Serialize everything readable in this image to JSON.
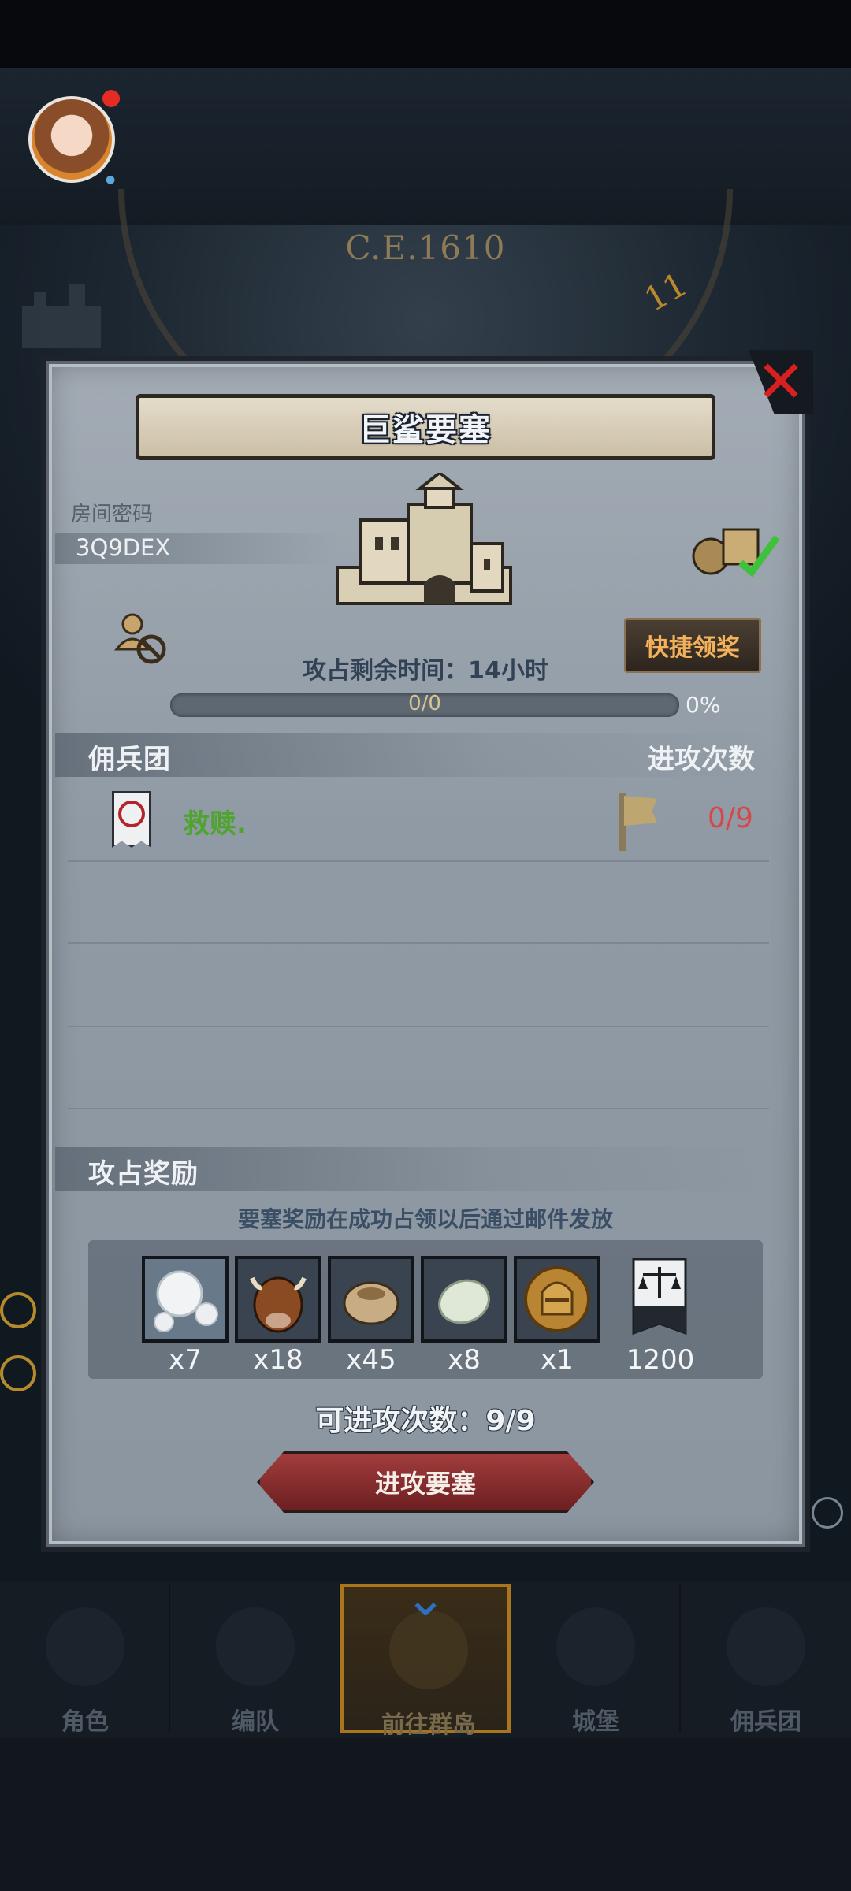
{
  "background": {
    "year": "C.E.1610",
    "clock_number": "11"
  },
  "dialog": {
    "title": "巨鲨要塞",
    "room_password_label": "房间密码",
    "room_password": "3Q9DEX",
    "quick_claim_label": "快捷领奖",
    "time_remaining": "攻占剩余时间：14小时",
    "progress_text": "0/0",
    "progress_percent": "0%",
    "progress_fraction": 0,
    "mercenary_header": "佣兵团",
    "attack_times_header": "进攻次数",
    "mercenaries": [
      {
        "name": "救赎.",
        "attacks": "0/9"
      }
    ],
    "rewards_header": "攻占奖励",
    "rewards_note": "要塞奖励在成功占领以后通过邮件发放",
    "rewards": [
      {
        "icon": "pearl-icon",
        "qty": "x7"
      },
      {
        "icon": "ox-icon",
        "qty": "x18"
      },
      {
        "icon": "grain-sack-icon",
        "qty": "x45"
      },
      {
        "icon": "gem-stone-icon",
        "qty": "x8"
      },
      {
        "icon": "knight-helmet-medal-icon",
        "qty": "x1"
      },
      {
        "icon": "justice-banner-icon",
        "qty": "1200"
      }
    ],
    "attacks_available": "可进攻次数：9/9",
    "attack_button": "进攻要塞"
  },
  "nav": {
    "items": [
      {
        "label": "角色",
        "icon": "character-icon"
      },
      {
        "label": "编队",
        "icon": "formation-icon"
      },
      {
        "label": "前往群岛",
        "icon": "globe-icon"
      },
      {
        "label": "城堡",
        "icon": "castle-icon"
      },
      {
        "label": "佣兵团",
        "icon": "mercenary-icon"
      }
    ],
    "active_index": 2
  },
  "colors": {
    "accent_gold": "#c79a3e",
    "attack_count_red": "#d54848",
    "merc_name_green": "#4ea42f",
    "button_red": "#8b2e2f"
  }
}
